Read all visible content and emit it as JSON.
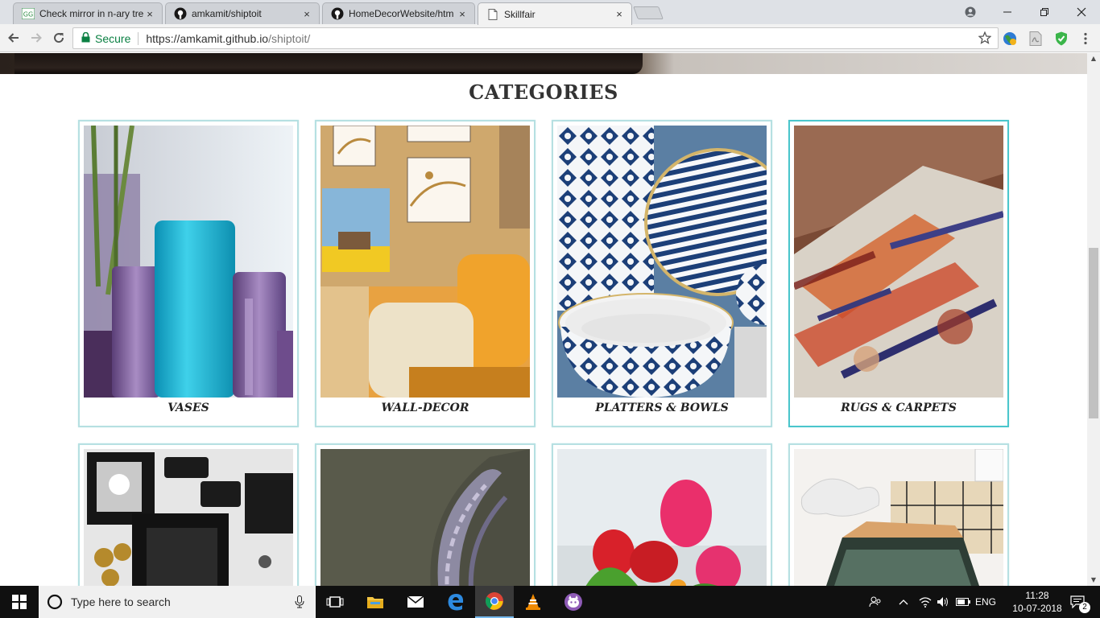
{
  "browser": {
    "tabs": [
      {
        "title": "Check mirror in n-ary tre",
        "favicon": "geeksforgeeks-icon",
        "active": false
      },
      {
        "title": "amkamit/shiptoit",
        "favicon": "github-icon",
        "active": false
      },
      {
        "title": "HomeDecorWebsite/htm",
        "favicon": "github-icon",
        "active": false
      },
      {
        "title": "Skillfair",
        "favicon": "page-icon",
        "active": true
      }
    ],
    "close_glyph": "×",
    "address": {
      "secure_label": "Secure",
      "url_host": "https://amkamit.github.io",
      "url_path": "/shiptoit/"
    }
  },
  "page": {
    "section_title": "CATEGORIES",
    "categories": [
      {
        "label": "VASES",
        "highlighted": false
      },
      {
        "label": "WALL-DECOR",
        "highlighted": false
      },
      {
        "label": "PLATTERS & BOWLS",
        "highlighted": false
      },
      {
        "label": "RUGS & CARPETS",
        "highlighted": true
      },
      {
        "label": "",
        "highlighted": false
      },
      {
        "label": "",
        "highlighted": false
      },
      {
        "label": "",
        "highlighted": false
      },
      {
        "label": "",
        "highlighted": false
      }
    ]
  },
  "taskbar": {
    "search_placeholder": "Type here to search",
    "language": "ENG",
    "time": "11:28",
    "date": "10-07-2018",
    "notification_count": "2"
  },
  "colors": {
    "card_border": "#b6e0e2",
    "card_border_hover": "#4ac6cc",
    "secure_green": "#0b8043"
  }
}
